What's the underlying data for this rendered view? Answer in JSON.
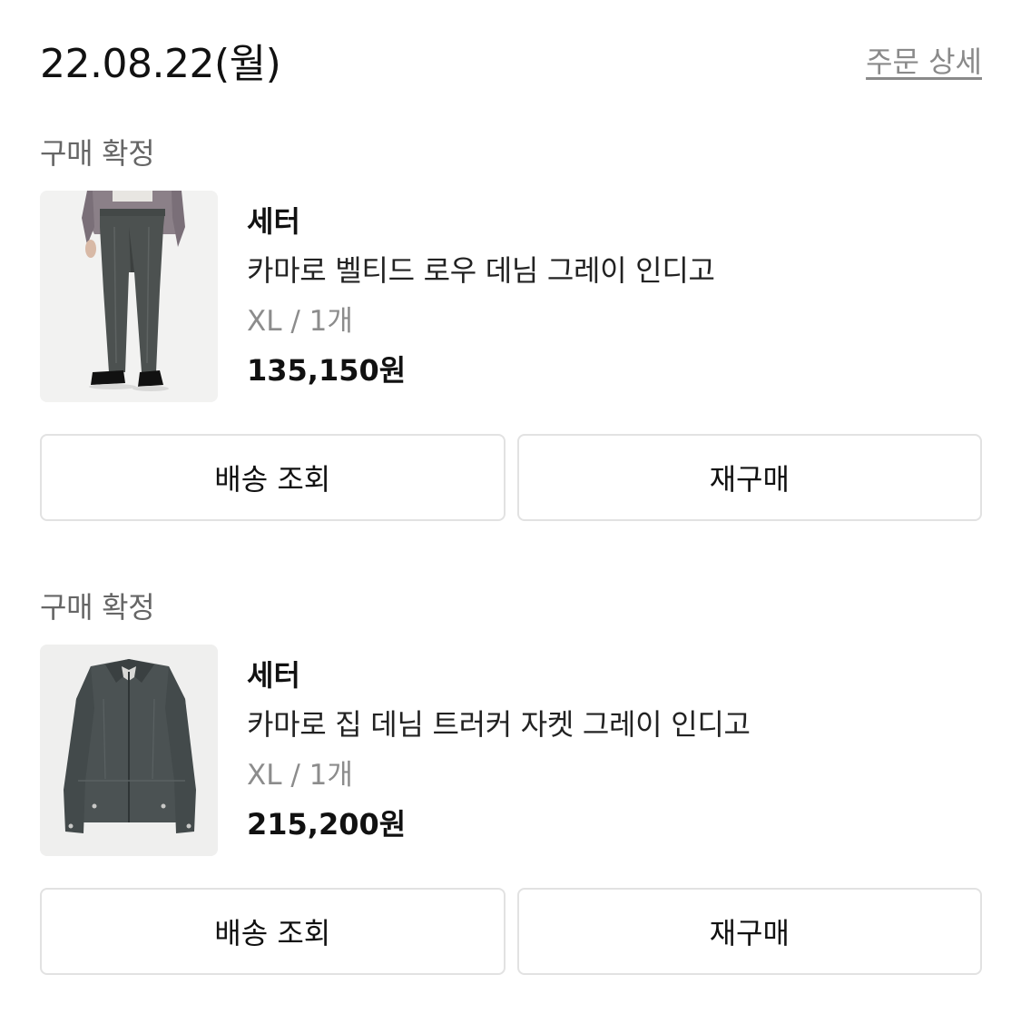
{
  "order": {
    "date": "22.08.22(월)",
    "detail_link": "주문 상세"
  },
  "items": [
    {
      "status": "구매 확정",
      "brand": "세터",
      "name": "카마로 벨티드 로우 데님 그레이 인디고",
      "option": "XL / 1개",
      "price": "135,150원",
      "image": "denim-pants-photo",
      "buttons": {
        "track": "배송 조회",
        "reorder": "재구매"
      }
    },
    {
      "status": "구매 확정",
      "brand": "세터",
      "name": "카마로 집 데님 트러커 자켓 그레이 인디고",
      "option": "XL / 1개",
      "price": "215,200원",
      "image": "denim-jacket-photo",
      "buttons": {
        "track": "배송 조회",
        "reorder": "재구매"
      }
    }
  ]
}
